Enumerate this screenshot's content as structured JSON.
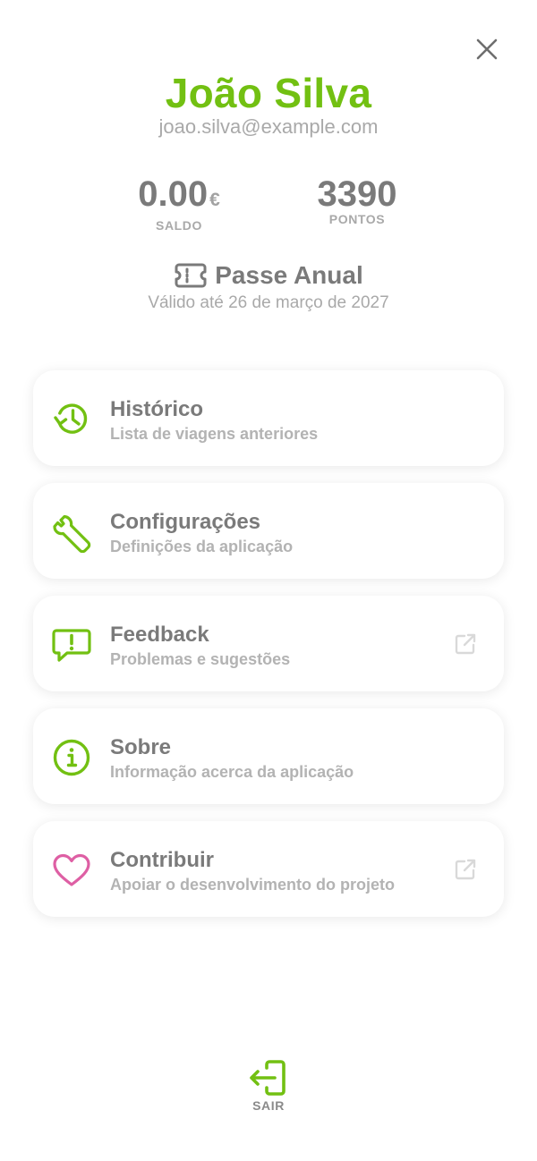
{
  "header": {
    "close_icon": "close-icon"
  },
  "user": {
    "name": "João Silva",
    "email": "joao.silva@example.com"
  },
  "stats": {
    "balance": {
      "value": "0.00",
      "currency": "€",
      "label": "SALDO"
    },
    "points": {
      "value": "3390",
      "label": "PONTOS"
    }
  },
  "pass": {
    "icon": "ticket-icon",
    "title": "Passe Anual",
    "validity": "Válido até 26 de março de 2027"
  },
  "menu": {
    "items": [
      {
        "title": "Histórico",
        "subtitle": "Lista de viagens anteriores",
        "icon": "history-icon",
        "icon_color": "#72c012",
        "external": false
      },
      {
        "title": "Configurações",
        "subtitle": "Definições da aplicação",
        "icon": "wrench-icon",
        "icon_color": "#72c012",
        "external": false
      },
      {
        "title": "Feedback",
        "subtitle": "Problemas e sugestões",
        "icon": "feedback-icon",
        "icon_color": "#72c012",
        "external": true
      },
      {
        "title": "Sobre",
        "subtitle": "Informação acerca da aplicação",
        "icon": "info-icon",
        "icon_color": "#72c012",
        "external": false
      },
      {
        "title": "Contribuir",
        "subtitle": "Apoiar o desenvolvimento do projeto",
        "icon": "heart-icon",
        "icon_color": "#de5fa4",
        "external": true
      }
    ]
  },
  "logout": {
    "label": "SAIR",
    "icon": "logout-icon"
  },
  "colors": {
    "accent": "#72c012",
    "heart": "#de5fa4",
    "text": "#7a7a7a",
    "muted": "#a9a9a9"
  }
}
